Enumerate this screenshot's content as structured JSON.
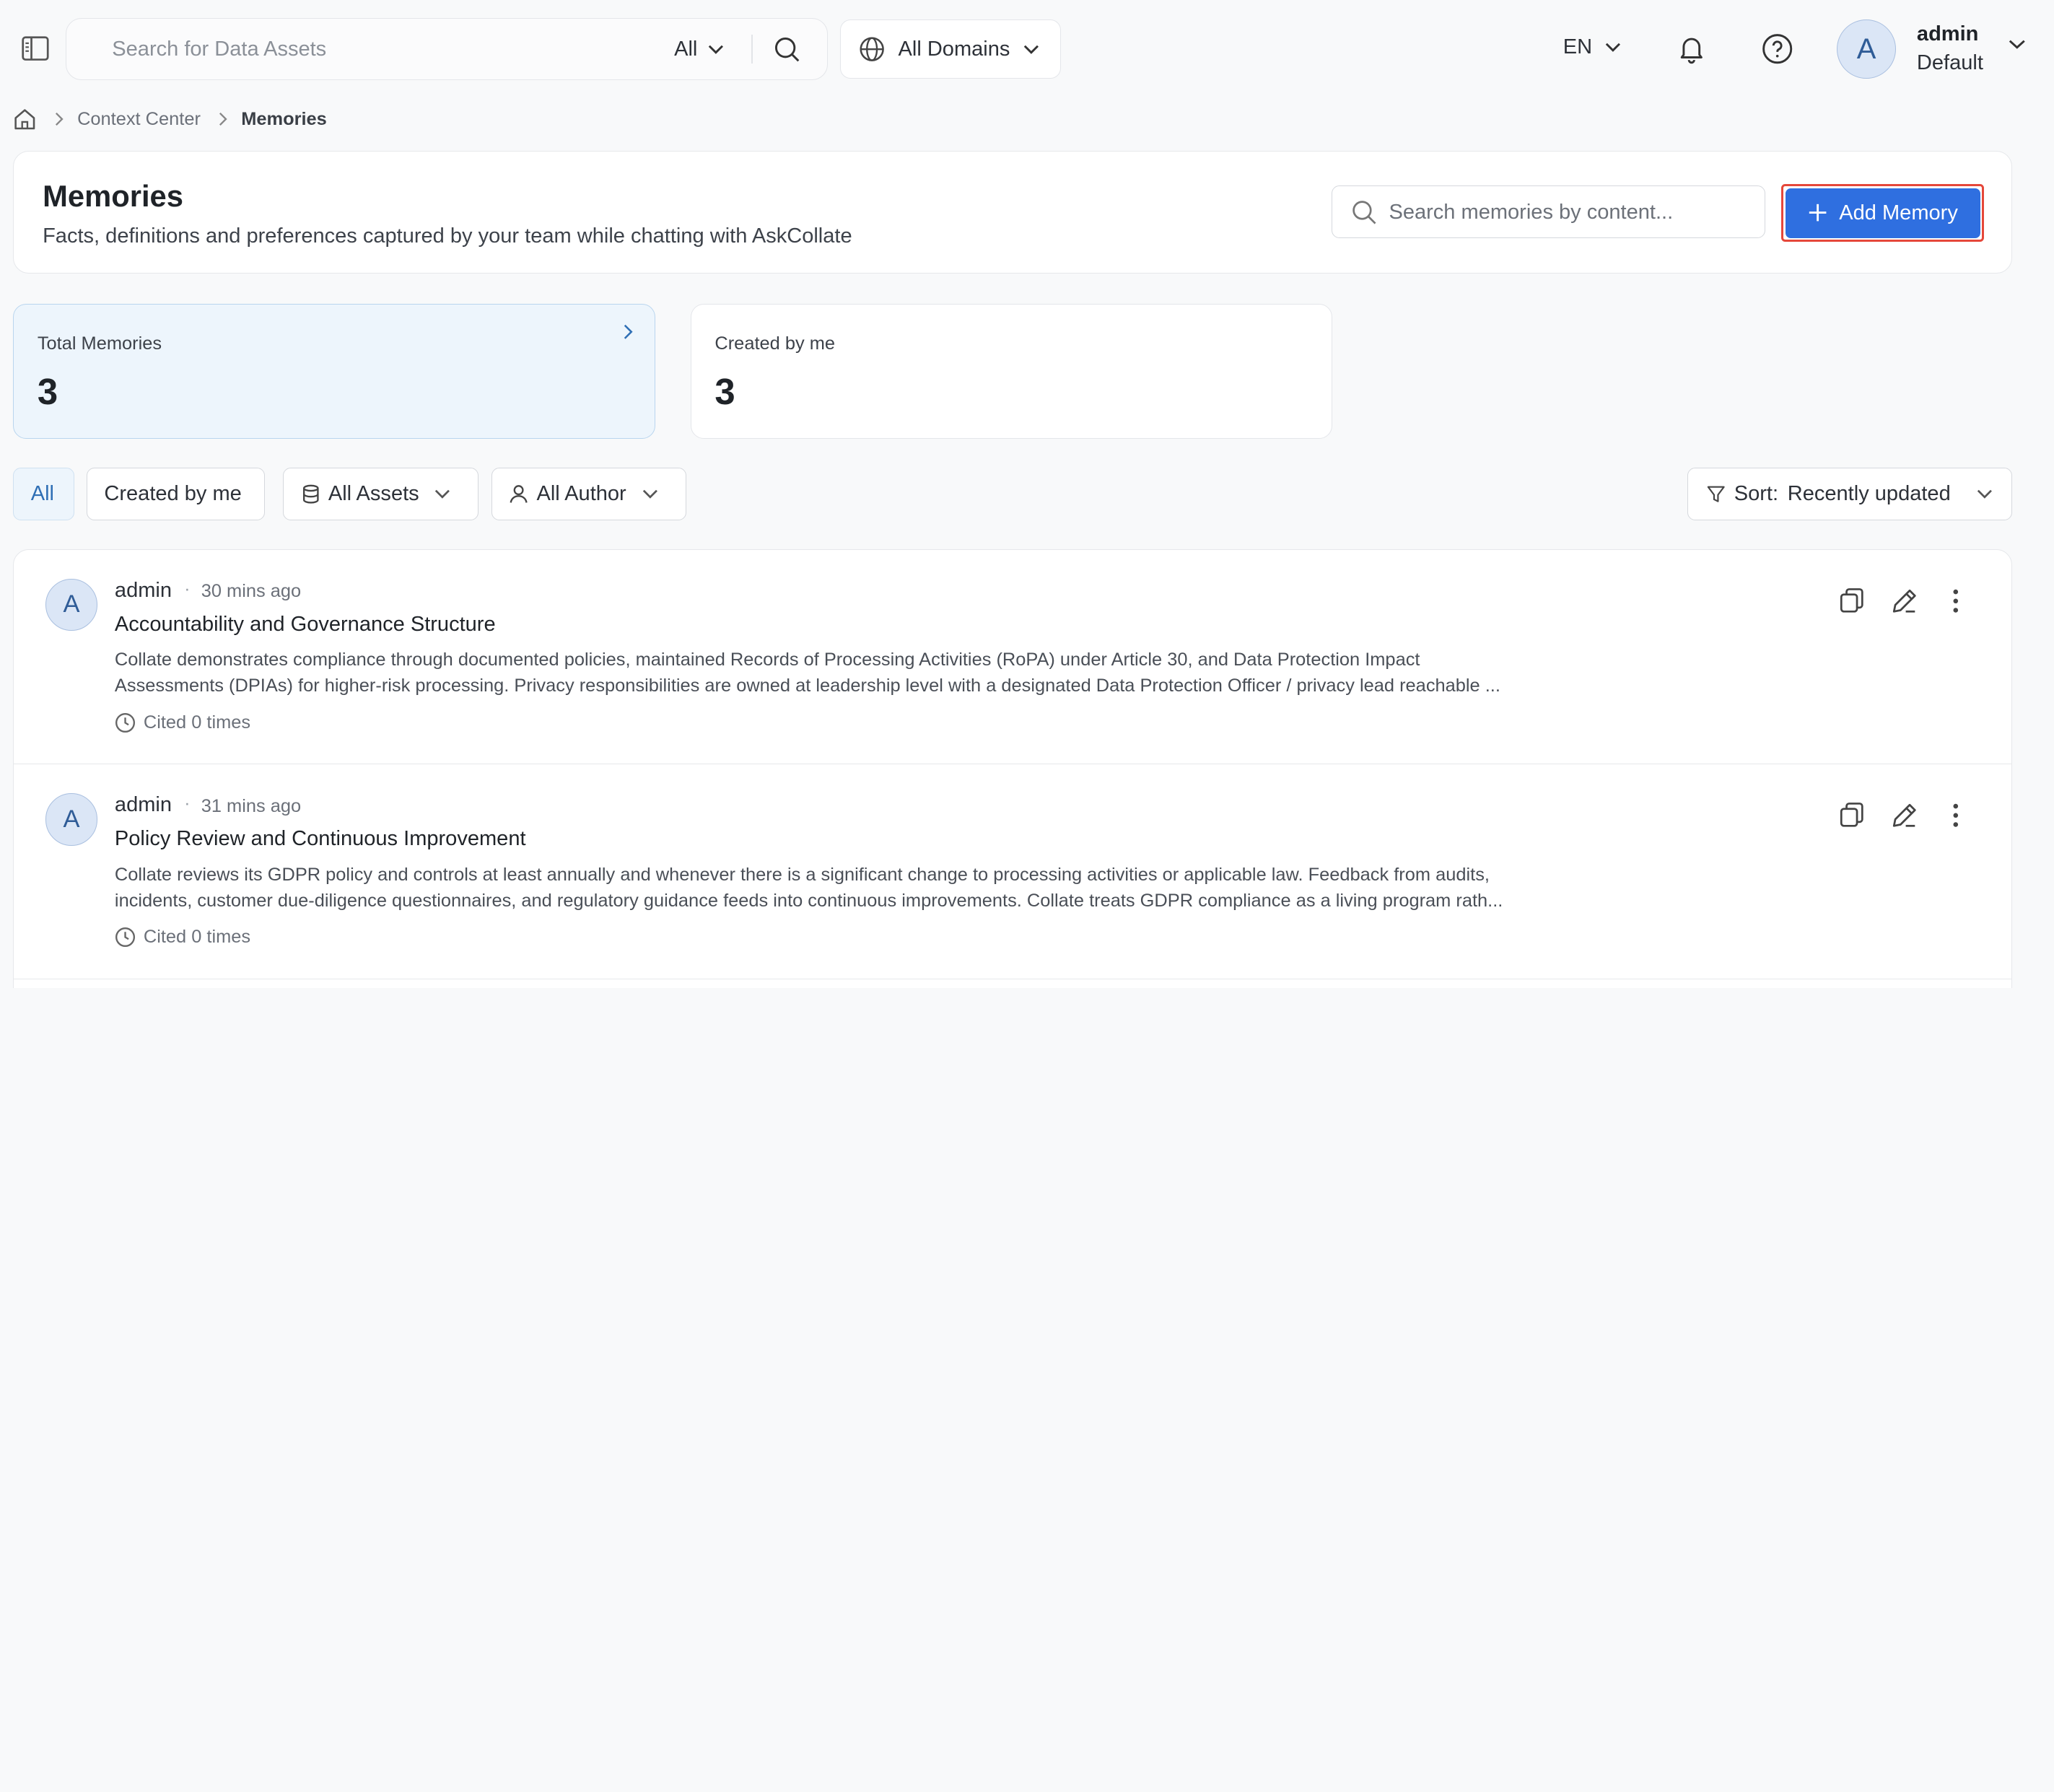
{
  "topbar": {
    "search_placeholder": "Search for Data Assets",
    "search_scope": "All",
    "domain_label": "All Domains",
    "language": "EN",
    "user": {
      "initial": "A",
      "name": "admin",
      "role": "Default"
    }
  },
  "breadcrumb": {
    "parent": "Context Center",
    "current": "Memories"
  },
  "header": {
    "title": "Memories",
    "subtitle": "Facts, definitions and preferences captured by your team while chatting with AskCollate",
    "search_placeholder": "Search memories by content...",
    "add_label": "Add Memory"
  },
  "stats": [
    {
      "label": "Total Memories",
      "value": "3"
    },
    {
      "label": "Created by me",
      "value": "3"
    }
  ],
  "filters": {
    "all": "All",
    "created_by_me": "Created by me",
    "assets": "All Assets",
    "author": "All Author",
    "sort_prefix": "Sort:",
    "sort_value": "Recently updated"
  },
  "memories": [
    {
      "initial": "A",
      "author": "admin",
      "separator": "·",
      "time": "30 mins ago",
      "title": "Accountability and Governance Structure",
      "body": "Collate demonstrates compliance through documented policies, maintained Records of Processing Activities (RoPA) under Article 30, and Data Protection Impact Assessments (DPIAs) for higher-risk processing. Privacy responsibilities are owned at leadership level with a designated Data Protection Officer / privacy lead reachable ...",
      "cited": "Cited 0 times"
    },
    {
      "initial": "A",
      "author": "admin",
      "separator": "·",
      "time": "31 mins ago",
      "title": "Policy Review and Continuous Improvement",
      "body": "Collate reviews its GDPR policy and controls at least annually and whenever there is a significant change to processing activities or applicable law. Feedback from audits, incidents, customer due-diligence questionnaires, and regulatory guidance feeds into continuous improvements. Collate treats GDPR compliance as a living program rath...",
      "cited": "Cited 0 times"
    }
  ],
  "colors": {
    "accent": "#2f6fe0",
    "focus_outline": "#e5473a",
    "active_chip": "#edf5fc"
  }
}
